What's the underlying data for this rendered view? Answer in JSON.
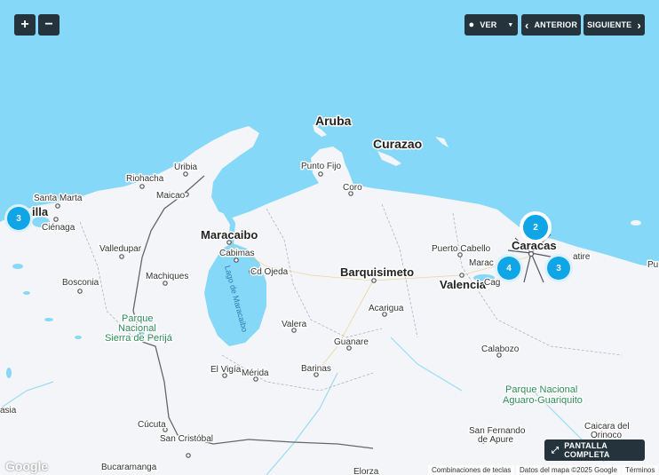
{
  "controls": {
    "zoom_in": "+",
    "zoom_out": "−",
    "view_label": "VER",
    "prev_label": "ANTERIOR",
    "next_label": "SIGUIENTE",
    "fullscreen_label": "PANTALLA COMPLETA"
  },
  "map": {
    "islands": [
      "Aruba",
      "Curazao"
    ],
    "cities": {
      "punto_fijo": "Punto Fijo",
      "coro": "Coro",
      "riohacha": "Riohacha",
      "uribia": "Uribia",
      "maicao": "Maicao",
      "santa_marta": "Santa Marta",
      "cienaga": "Ciénaga",
      "barranquilla_fragment": "illa",
      "valledupar": "Valledupar",
      "bosconia": "Bosconia",
      "machiques": "Machiques",
      "maracaibo": "Maracaibo",
      "cabimas": "Cabimas",
      "cd_ojeda": "Cd Ojeda",
      "valera": "Valera",
      "el_vigia": "El Vigía",
      "merida": "Mérida",
      "barinas": "Barinas",
      "guanare": "Guanare",
      "acarigua": "Acarigua",
      "barquisimeto": "Barquisimeto",
      "puerto_cabello": "Puerto Cabello",
      "valencia": "Valencia",
      "maracay_fragment": "Marac",
      "caracas": "Caracas",
      "cagua_fragment": "Cag",
      "catire_fragment": "atire",
      "pu_fragment": "Pu",
      "calabozo": "Calabozo",
      "cucuta": "Cúcuta",
      "san_cristobal": "San Cristóbal",
      "san_fernando": "San Fernando",
      "de_apure": "de Apure",
      "caicara": "Caicara del",
      "orinoco": "Orinoco",
      "bucaramanga": "Bucaramanga",
      "elorza": "Elorza",
      "asia_fragment": "asia"
    },
    "lake_label": "Lago de Maracaibo",
    "parks": {
      "perija_1": "Parque",
      "perija_2": "Nacional",
      "perija_3": "Sierra de Perijá",
      "aguaro_1": "Parque Nacional",
      "aguaro_2": "Aguaro-Guariquito"
    }
  },
  "clusters": [
    {
      "id": "west",
      "count": "3"
    },
    {
      "id": "caracas-top",
      "count": "2"
    },
    {
      "id": "maracay",
      "count": "4"
    },
    {
      "id": "guarenas",
      "count": "3"
    }
  ],
  "footer": {
    "google": "Google",
    "shortcuts": "Combinaciones de teclas",
    "map_data": "Datos del mapa ©2025 Google",
    "terms": "Términos"
  },
  "colors": {
    "water": "#86d8f8",
    "land": "#f4f5f8",
    "control_bg": "#25333d",
    "cluster": "#10a5e6",
    "park_text": "#2e8b57"
  }
}
